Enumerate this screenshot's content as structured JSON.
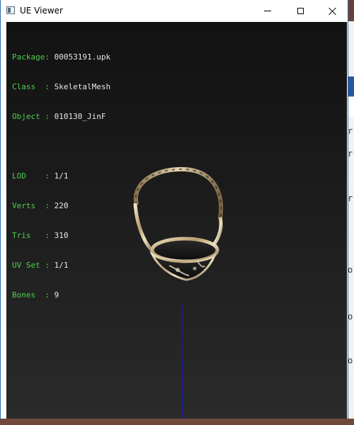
{
  "window": {
    "title": "UE Viewer",
    "icon": "app-window-icon",
    "controls": {
      "minimize": "minimize-icon",
      "maximize": "maximize-icon",
      "close": "close-icon"
    }
  },
  "info_top": [
    {
      "key": "Package",
      "sep": ": ",
      "value": "00053191.upk"
    },
    {
      "key": "Class  ",
      "sep": ": ",
      "value": "SkeletalMesh"
    },
    {
      "key": "Object ",
      "sep": ": ",
      "value": "010130_JinF"
    }
  ],
  "info_stats": [
    {
      "key": "LOD    ",
      "sep": ": ",
      "value": "1/1"
    },
    {
      "key": "Verts  ",
      "sep": ": ",
      "value": "220"
    },
    {
      "key": "Tris   ",
      "sep": ": ",
      "value": "310"
    },
    {
      "key": "UV Set ",
      "sep": ": ",
      "value": "1/1"
    },
    {
      "key": "Bones  ",
      "sep": ": ",
      "value": "9"
    }
  ],
  "background_glyphs": [
    "r",
    "r",
    "r",
    "o",
    "o",
    "o"
  ],
  "colors": {
    "label": "#4ccf4c",
    "value": "#e8e8e8",
    "axis": "#1a1aa8",
    "ring_metal": "#c9b48a"
  }
}
